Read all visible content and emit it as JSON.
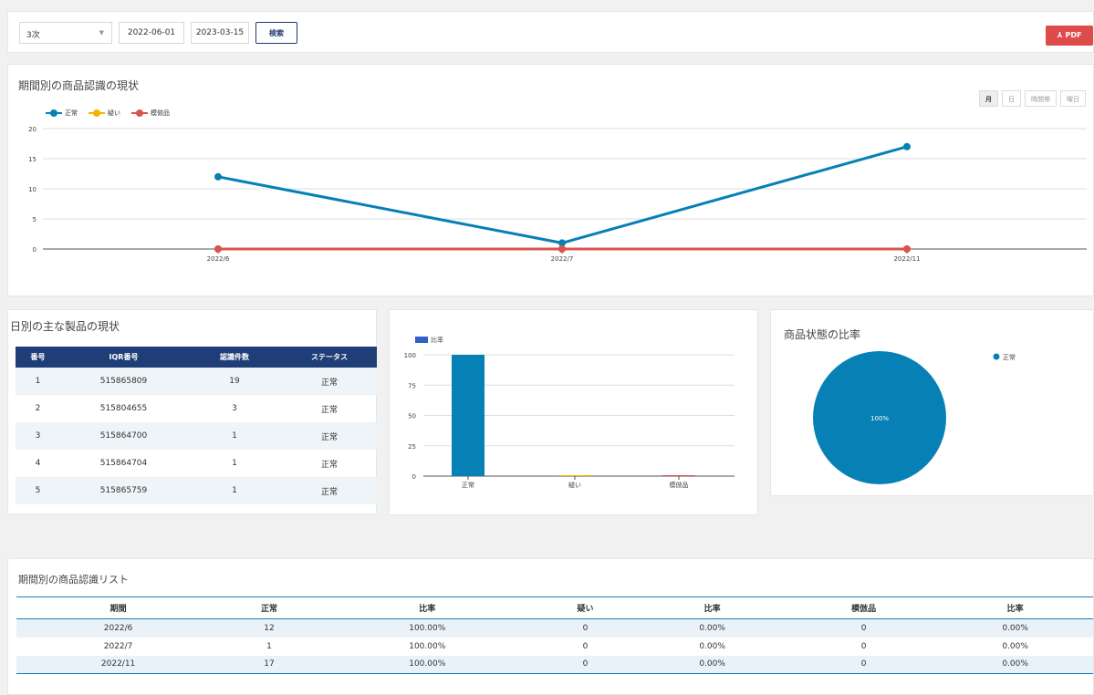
{
  "toolbar": {
    "select_value": "3次",
    "start_date": "2022-06-01",
    "end_date": "2023-03-15",
    "search_label": "検索",
    "pdf_label": "PDF"
  },
  "trend": {
    "title": "期間別の商品認識の現状",
    "period_buttons": [
      "月",
      "日",
      "時間帯",
      "曜日"
    ],
    "active_period": "月"
  },
  "products": {
    "title": "日別の主な製品の現状",
    "columns": [
      "番号",
      "IQR番号",
      "認識件数",
      "ステータス"
    ],
    "rows": [
      [
        "1",
        "515865809",
        "19",
        "正常"
      ],
      [
        "2",
        "515804655",
        "3",
        "正常"
      ],
      [
        "3",
        "515864700",
        "1",
        "正常"
      ],
      [
        "4",
        "515864704",
        "1",
        "正常"
      ],
      [
        "5",
        "515865759",
        "1",
        "正常"
      ]
    ]
  },
  "ratio": {
    "title": "商品状態の比率"
  },
  "list": {
    "title": "期間別の商品認識リスト",
    "columns": [
      "期間",
      "正常",
      "比率",
      "疑い",
      "比率",
      "模倣品",
      "比率"
    ],
    "rows": [
      [
        "2022/6",
        "12",
        "100.00%",
        "0",
        "0.00%",
        "0",
        "0.00%"
      ],
      [
        "2022/7",
        "1",
        "100.00%",
        "0",
        "0.00%",
        "0",
        "0.00%"
      ],
      [
        "2022/11",
        "17",
        "100.00%",
        "0",
        "0.00%",
        "0",
        "0.00%"
      ]
    ]
  },
  "colors": {
    "normal": "#0780b5",
    "suspect": "#f2b600",
    "fake": "#d9534f",
    "navy": "#1f3e77",
    "bar_legend": "#3060c8"
  },
  "chart_data": [
    {
      "type": "line",
      "categories": [
        "2022/6",
        "2022/7",
        "2022/11"
      ],
      "series": [
        {
          "name": "正常",
          "values": [
            12,
            1,
            17
          ]
        },
        {
          "name": "疑い",
          "values": [
            0,
            0,
            0
          ]
        },
        {
          "name": "模倣品",
          "values": [
            0,
            0,
            0
          ]
        }
      ],
      "yticks": [
        0,
        5,
        10,
        15,
        20
      ],
      "ylim": [
        0,
        20
      ],
      "legend": "top-left",
      "grid": true
    },
    {
      "type": "bar",
      "categories": [
        "正常",
        "疑い",
        "模倣品"
      ],
      "series": [
        {
          "name": "比率",
          "values": [
            100,
            0,
            0
          ]
        }
      ],
      "yticks": [
        0,
        25,
        50,
        75,
        100
      ],
      "ylim": [
        0,
        100
      ],
      "legend": "top-left",
      "grid": true
    },
    {
      "type": "pie",
      "slices": [
        {
          "name": "正常",
          "value": 100,
          "label": "100%"
        }
      ],
      "legend": "top-right"
    }
  ]
}
